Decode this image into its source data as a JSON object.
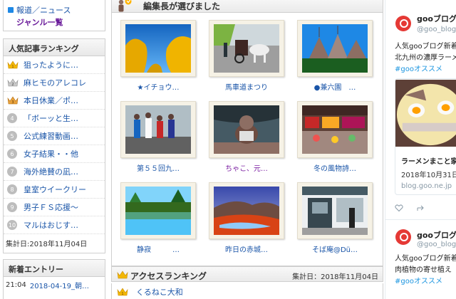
{
  "left": {
    "top_links": [
      {
        "label": "報道／ニュース"
      },
      {
        "label": "ジャンル一覧"
      }
    ],
    "ranking": {
      "title": "人気記事ランキング",
      "items": [
        {
          "rank": "1",
          "title": "狙ったように…"
        },
        {
          "rank": "2",
          "title": "麻ヒモのアレコレ"
        },
        {
          "rank": "3",
          "title": "本日休業／ポ…"
        },
        {
          "rank": "4",
          "title": "「ボーッと生…"
        },
        {
          "rank": "5",
          "title": "公式練習動画…"
        },
        {
          "rank": "6",
          "title": "女子結果・・他"
        },
        {
          "rank": "7",
          "title": "海外絶賛の凪…"
        },
        {
          "rank": "8",
          "title": "皇室ウイークリー"
        },
        {
          "rank": "9",
          "title": "男子ＦＳ応援～"
        },
        {
          "rank": "10",
          "title": "マルはおじす…"
        }
      ],
      "tally": "集計日:2018年11月04日"
    },
    "new_entries": {
      "title": "新着エントリー",
      "items": [
        {
          "time": "21:04",
          "title": "2018-04-19_朝…"
        }
      ]
    }
  },
  "center": {
    "editor_title": "編集長が選びました",
    "picks": [
      {
        "caption": "★イチョウ…",
        "visited": false
      },
      {
        "caption": "馬車道まつり",
        "visited": false
      },
      {
        "caption": "●兼六園　…",
        "visited": false
      },
      {
        "caption": "第５５回九…",
        "visited": false
      },
      {
        "caption": "ちゃこ、元…",
        "visited": true
      },
      {
        "caption": "冬の風物詩…",
        "visited": false
      },
      {
        "caption": "静寂　　　…",
        "visited": false
      },
      {
        "caption": "昨日の赤城…",
        "visited": false
      },
      {
        "caption": "そば庵@Dü…",
        "visited": false
      }
    ],
    "access_ranking": {
      "title": "アクセスランキング",
      "tally": "集計日：2018年11月04日",
      "items": [
        {
          "rank": "1",
          "title": "くるねこ大和"
        }
      ]
    }
  },
  "right": {
    "tweets": [
      {
        "name": "gooブログ",
        "handle": "@goo_blog",
        "lines": [
          "人気gooブログ新着を",
          "北九州の濃厚ラーメ"
        ],
        "hashtag": "#gooオススメ",
        "card": {
          "title": "ラーメンまこと家",
          "date": "2018年10月31日(",
          "url": "blog.goo.ne.jp"
        }
      },
      {
        "name": "gooブログ",
        "handle": "@goo_blog",
        "lines": [
          "人気gooブログ新着を",
          "肉植物の寄せ植え"
        ],
        "hashtag": "#gooオススメ"
      }
    ]
  },
  "colors": {
    "link": "#1a55a8",
    "visited": "#7b1fa2",
    "twitter_blue": "#1b95e0",
    "goo_red": "#e53935"
  }
}
